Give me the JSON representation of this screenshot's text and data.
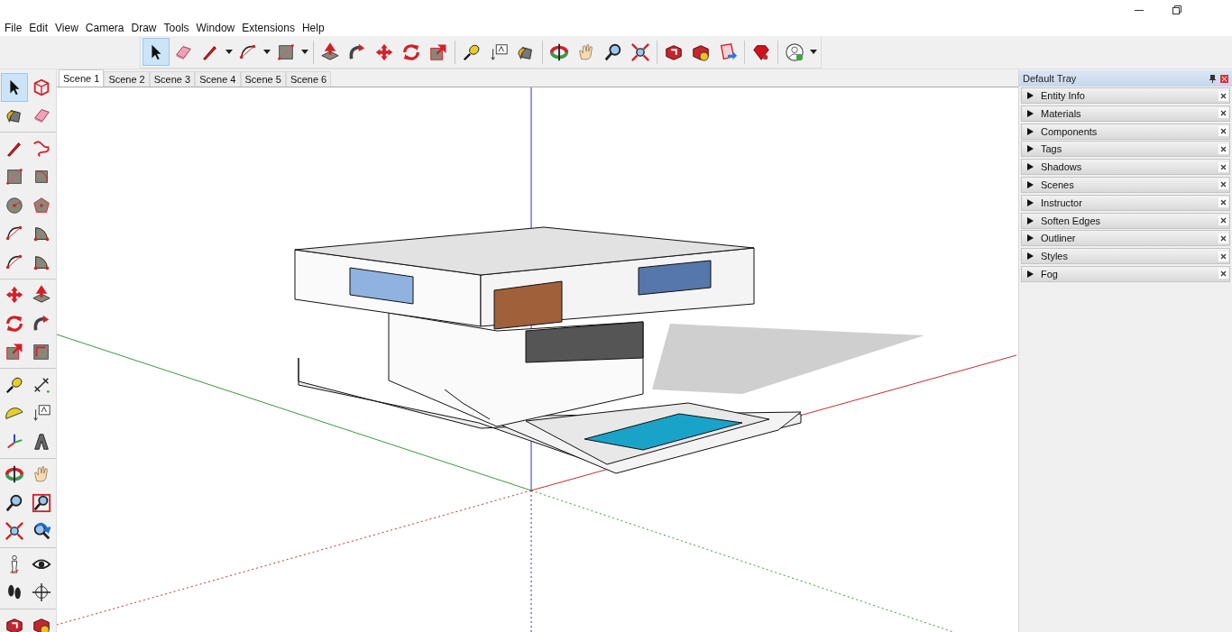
{
  "menu": [
    "File",
    "Edit",
    "View",
    "Camera",
    "Draw",
    "Tools",
    "Window",
    "Extensions",
    "Help"
  ],
  "toolbar": [
    [
      {
        "kind": "select",
        "selected": true,
        "dropdown": false
      },
      {
        "kind": "eraser",
        "selected": false,
        "dropdown": false
      },
      {
        "kind": "pencil",
        "selected": false,
        "dropdown": true
      },
      {
        "kind": "arc",
        "selected": false,
        "dropdown": true
      },
      {
        "kind": "rect",
        "selected": false,
        "dropdown": true
      }
    ],
    [
      {
        "kind": "pushpull",
        "selected": false,
        "dropdown": false
      },
      {
        "kind": "followme",
        "selected": false,
        "dropdown": false
      },
      {
        "kind": "move",
        "selected": false,
        "dropdown": false
      },
      {
        "kind": "rotate",
        "selected": false,
        "dropdown": false
      },
      {
        "kind": "scale",
        "selected": false,
        "dropdown": false
      }
    ],
    [
      {
        "kind": "tape",
        "selected": false,
        "dropdown": false
      },
      {
        "kind": "text",
        "selected": false,
        "dropdown": false
      },
      {
        "kind": "paint",
        "selected": false,
        "dropdown": false
      }
    ],
    [
      {
        "kind": "orbit",
        "selected": false,
        "dropdown": false
      },
      {
        "kind": "pan",
        "selected": false,
        "dropdown": false
      },
      {
        "kind": "zoom",
        "selected": false,
        "dropdown": false
      },
      {
        "kind": "zoomext",
        "selected": false,
        "dropdown": false
      }
    ],
    [
      {
        "kind": "warehouse",
        "selected": false,
        "dropdown": false
      },
      {
        "kind": "extwarehouse",
        "selected": false,
        "dropdown": false
      },
      {
        "kind": "share",
        "selected": false,
        "dropdown": false
      }
    ],
    [
      {
        "kind": "ruby",
        "selected": false,
        "dropdown": false
      }
    ],
    [
      {
        "kind": "account",
        "selected": false,
        "dropdown": true
      }
    ]
  ],
  "palette": [
    [
      {
        "kind": "select",
        "selected": true
      },
      {
        "kind": "component",
        "selected": false
      },
      {
        "kind": "paint",
        "selected": false
      },
      {
        "kind": "eraser",
        "selected": false
      }
    ],
    [
      {
        "kind": "pencil",
        "selected": false
      },
      {
        "kind": "freehand",
        "selected": false
      },
      {
        "kind": "rect",
        "selected": false
      },
      {
        "kind": "rotrect",
        "selected": false
      },
      {
        "kind": "circle",
        "selected": false
      },
      {
        "kind": "polygon",
        "selected": false
      },
      {
        "kind": "arc",
        "selected": false
      },
      {
        "kind": "pie",
        "selected": false
      },
      {
        "kind": "arc",
        "selected": false
      },
      {
        "kind": "pie",
        "selected": false
      }
    ],
    [
      {
        "kind": "move",
        "selected": false
      },
      {
        "kind": "pushpull",
        "selected": false
      },
      {
        "kind": "rotate",
        "selected": false
      },
      {
        "kind": "followme",
        "selected": false
      },
      {
        "kind": "scale",
        "selected": false
      },
      {
        "kind": "offset",
        "selected": false
      }
    ],
    [
      {
        "kind": "tape",
        "selected": false
      },
      {
        "kind": "dims",
        "selected": false
      },
      {
        "kind": "protractor",
        "selected": false
      },
      {
        "kind": "text",
        "selected": false
      },
      {
        "kind": "axes",
        "selected": false
      },
      {
        "kind": "text3d",
        "selected": false
      }
    ],
    [
      {
        "kind": "orbit",
        "selected": false
      },
      {
        "kind": "pan",
        "selected": false
      },
      {
        "kind": "zoom",
        "selected": false
      },
      {
        "kind": "zoomwin",
        "selected": false
      },
      {
        "kind": "zoomext",
        "selected": false
      },
      {
        "kind": "prev",
        "selected": false
      }
    ],
    [
      {
        "kind": "camera",
        "selected": false
      },
      {
        "kind": "look",
        "selected": false
      },
      {
        "kind": "walk",
        "selected": false
      },
      {
        "kind": "section",
        "selected": false
      }
    ],
    [
      {
        "kind": "warehouse",
        "selected": false
      },
      {
        "kind": "extwarehouse",
        "selected": false
      }
    ]
  ],
  "scenes": [
    {
      "label": "Scene 1",
      "selected": true
    },
    {
      "label": "Scene 2",
      "selected": false
    },
    {
      "label": "Scene 3",
      "selected": false
    },
    {
      "label": "Scene 4",
      "selected": false
    },
    {
      "label": "Scene 5",
      "selected": false
    },
    {
      "label": "Scene 6",
      "selected": false
    }
  ],
  "tray": {
    "title": "Default Tray",
    "panels": [
      {
        "label": "Entity Info",
        "expanded": false
      },
      {
        "label": "Materials",
        "expanded": false
      },
      {
        "label": "Components",
        "expanded": false
      },
      {
        "label": "Tags",
        "expanded": false
      },
      {
        "label": "Shadows",
        "expanded": false
      },
      {
        "label": "Scenes",
        "expanded": false
      },
      {
        "label": "Instructor",
        "expanded": false
      },
      {
        "label": "Soften Edges",
        "expanded": false
      },
      {
        "label": "Outliner",
        "expanded": false
      },
      {
        "label": "Styles",
        "expanded": false
      },
      {
        "label": "Fog",
        "expanded": false
      }
    ]
  }
}
